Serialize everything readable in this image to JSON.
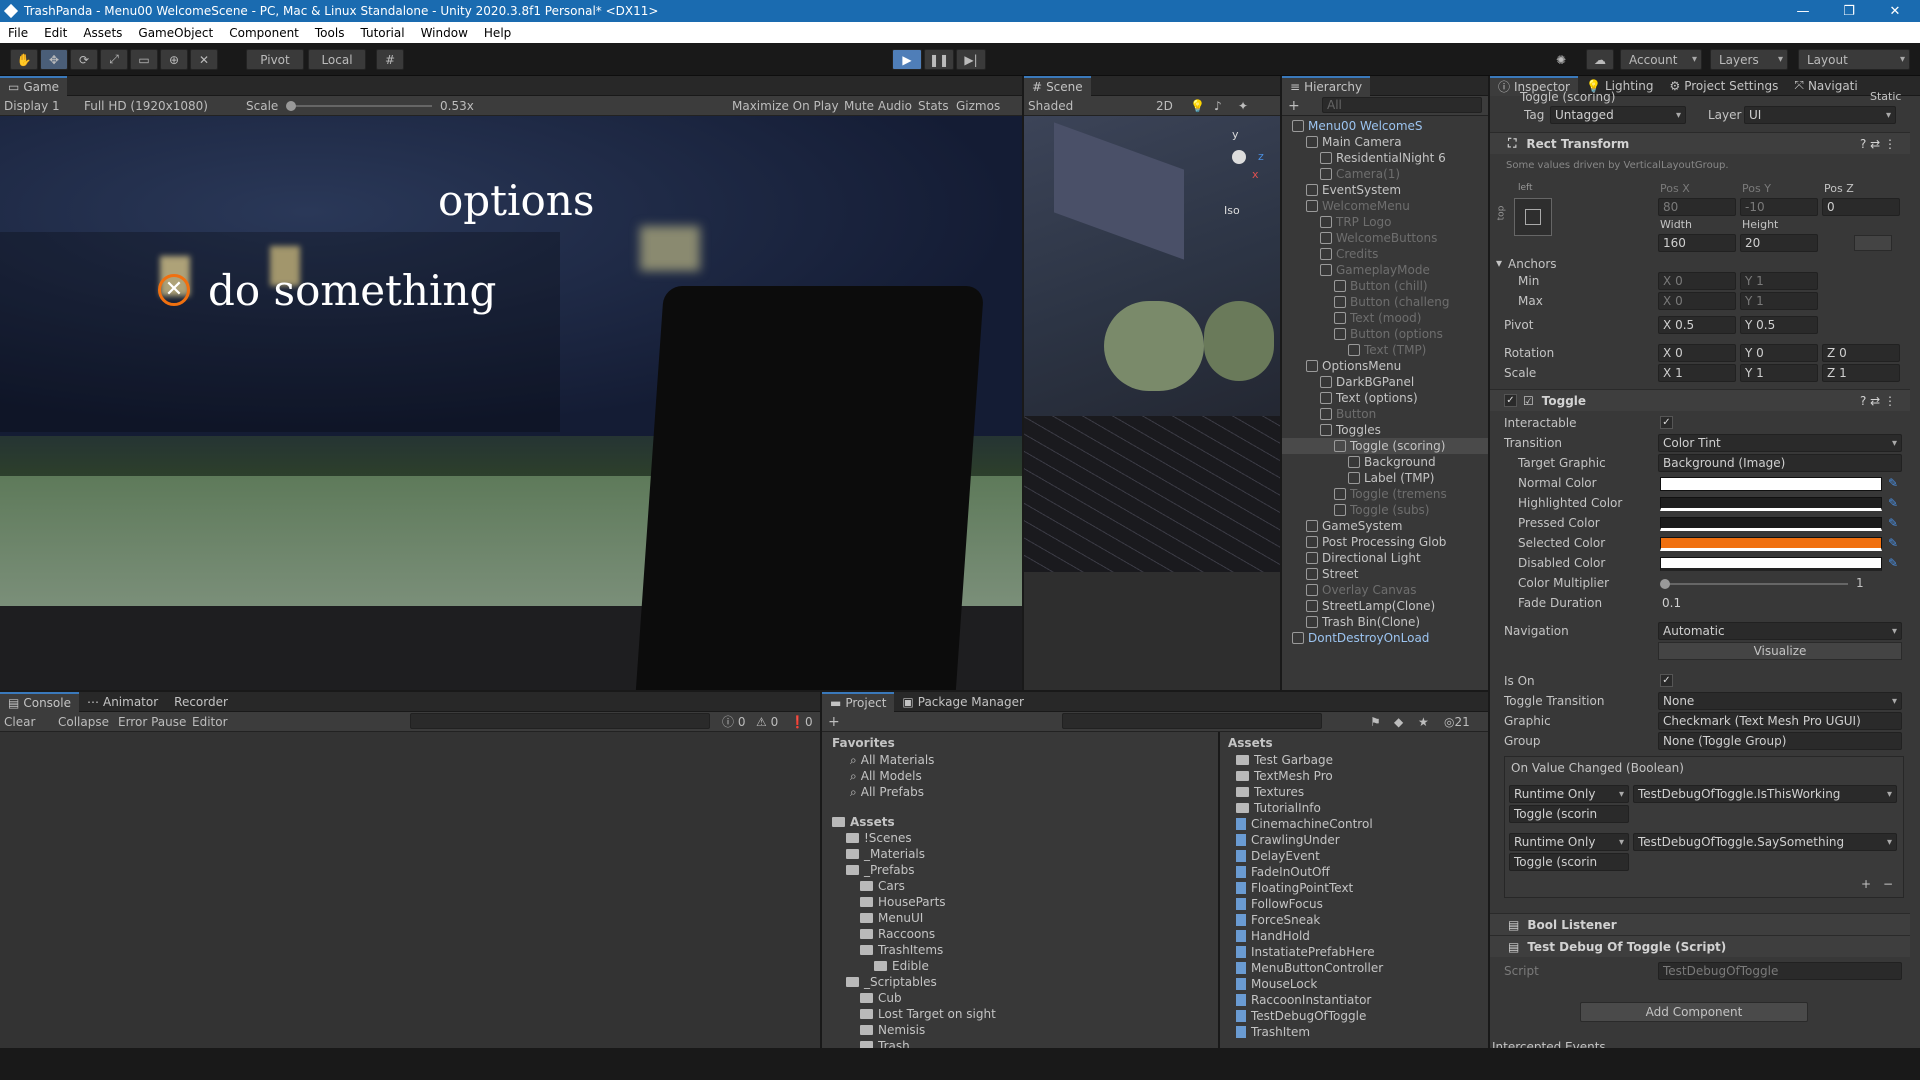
{
  "app": {
    "title": "TrashPanda - Menu00 WelcomeScene - PC, Mac & Linux Standalone - Unity 2020.3.8f1 Personal* <DX11>",
    "minimize": "—",
    "restore": "❐",
    "close": "✕"
  },
  "menu": [
    "File",
    "Edit",
    "Assets",
    "GameObject",
    "Component",
    "Tools",
    "Tutorial",
    "Window",
    "Help"
  ],
  "toolbar": {
    "pivot": "Pivot",
    "local": "Local",
    "account": "Account",
    "layers": "Layers",
    "layout": "Layout"
  },
  "game": {
    "tab": "Game",
    "display": "Display 1",
    "resolution": "Full HD (1920x1080)",
    "scale_label": "Scale",
    "scale_value": "0.53x",
    "maximize": "Maximize On Play",
    "mute": "Mute Audio",
    "stats": "Stats",
    "gizmos": "Gizmos",
    "overlay_title": "options",
    "overlay_item": "do something"
  },
  "scene": {
    "tab": "Scene",
    "shading": "Shaded",
    "mode2d": "2D",
    "iso": "Iso",
    "axis_y": "y",
    "axis_z": "z",
    "axis_x": "x"
  },
  "hierarchy": {
    "tab": "Hierarchy",
    "search_placeholder": "All",
    "items": [
      {
        "label": "Menu00 WelcomeS",
        "indent": 0,
        "state": "bold"
      },
      {
        "label": "Main Camera",
        "indent": 1,
        "state": ""
      },
      {
        "label": "ResidentialNight 6",
        "indent": 2,
        "state": ""
      },
      {
        "label": "Camera(1)",
        "indent": 2,
        "state": "dim"
      },
      {
        "label": "EventSystem",
        "indent": 1,
        "state": ""
      },
      {
        "label": "WelcomeMenu",
        "indent": 1,
        "state": "dim"
      },
      {
        "label": "TRP Logo",
        "indent": 2,
        "state": "dim"
      },
      {
        "label": "WelcomeButtons",
        "indent": 2,
        "state": "dim"
      },
      {
        "label": "Credits",
        "indent": 2,
        "state": "dim"
      },
      {
        "label": "GameplayMode",
        "indent": 2,
        "state": "dim"
      },
      {
        "label": "Button (chill)",
        "indent": 3,
        "state": "dim"
      },
      {
        "label": "Button (challeng",
        "indent": 3,
        "state": "dim"
      },
      {
        "label": "Text (mood)",
        "indent": 3,
        "state": "dim"
      },
      {
        "label": "Button (options",
        "indent": 3,
        "state": "dim"
      },
      {
        "label": "Text (TMP)",
        "indent": 4,
        "state": "dim"
      },
      {
        "label": "OptionsMenu",
        "indent": 1,
        "state": ""
      },
      {
        "label": "DarkBGPanel",
        "indent": 2,
        "state": ""
      },
      {
        "label": "Text (options)",
        "indent": 2,
        "state": ""
      },
      {
        "label": "Button",
        "indent": 2,
        "state": "dim"
      },
      {
        "label": "Toggles",
        "indent": 2,
        "state": ""
      },
      {
        "label": "Toggle (scoring)",
        "indent": 3,
        "state": "selected"
      },
      {
        "label": "Background",
        "indent": 4,
        "state": ""
      },
      {
        "label": "Label (TMP)",
        "indent": 4,
        "state": ""
      },
      {
        "label": "Toggle (tremens",
        "indent": 3,
        "state": "dim"
      },
      {
        "label": "Toggle (subs)",
        "indent": 3,
        "state": "dim"
      },
      {
        "label": "GameSystem",
        "indent": 1,
        "state": ""
      },
      {
        "label": "Post Processing Glob",
        "indent": 1,
        "state": ""
      },
      {
        "label": "Directional Light",
        "indent": 1,
        "state": ""
      },
      {
        "label": "Street",
        "indent": 1,
        "state": ""
      },
      {
        "label": "Overlay Canvas",
        "indent": 1,
        "state": "dim"
      },
      {
        "label": "StreetLamp(Clone)",
        "indent": 1,
        "state": ""
      },
      {
        "label": "Trash Bin(Clone)",
        "indent": 1,
        "state": ""
      },
      {
        "label": "DontDestroyOnLoad",
        "indent": 0,
        "state": "bold"
      }
    ]
  },
  "inspector": {
    "tabs": [
      "Inspector",
      "Lighting",
      "Project Settings",
      "Navigati"
    ],
    "object_name": "Toggle (scoring)",
    "static": "Static",
    "tag_label": "Tag",
    "tag_value": "Untagged",
    "layer_label": "Layer",
    "layer_value": "UI",
    "rect": {
      "title": "Rect Transform",
      "note": "Some values driven by VerticalLayoutGroup.",
      "anchor_preset": "left",
      "anchor_side": "top",
      "posx_label": "Pos X",
      "posy_label": "Pos Y",
      "posz_label": "Pos Z",
      "posx": "80",
      "posy": "-10",
      "posz": "0",
      "width_label": "Width",
      "height_label": "Height",
      "width": "160",
      "height": "20",
      "anchors": "Anchors",
      "min": "Min",
      "max": "Max",
      "min_x": "0",
      "min_y": "1",
      "max_x": "0",
      "max_y": "1",
      "pivot": "Pivot",
      "pivot_x": "0.5",
      "pivot_y": "0.5",
      "rotation": "Rotation",
      "rot_x": "0",
      "rot_y": "0",
      "rot_z": "0",
      "scale": "Scale",
      "scale_x": "1",
      "scale_y": "1",
      "scale_z": "1",
      "x": "X",
      "y": "Y",
      "z": "Z"
    },
    "toggle": {
      "title": "Toggle",
      "interactable": "Interactable",
      "transition": "Transition",
      "transition_value": "Color Tint",
      "target_graphic": "Target Graphic",
      "target_graphic_value": "Background (Image)",
      "normal": "Normal Color",
      "highlighted": "Highlighted Color",
      "pressed": "Pressed Color",
      "selected": "Selected Color",
      "disabled": "Disabled Color",
      "multiplier": "Color Multiplier",
      "multiplier_value": "1",
      "fade": "Fade Duration",
      "fade_value": "0.1",
      "navigation": "Navigation",
      "navigation_value": "Automatic",
      "visualize": "Visualize",
      "is_on": "Is On",
      "toggle_transition": "Toggle Transition",
      "toggle_transition_value": "None",
      "graphic": "Graphic",
      "graphic_value": "Checkmark (Text Mesh Pro UGUI)",
      "group": "Group",
      "group_value": "None (Toggle Group)",
      "event": "On Value Changed (Boolean)",
      "runtime": "Runtime Only",
      "fn1": "TestDebugOfToggle.IsThisWorking",
      "fn2": "TestDebugOfToggle.SaySomething",
      "obj": "Toggle (scorin",
      "plus": "+",
      "minus": "−"
    },
    "colors": {
      "normal": "#ffffff",
      "highlighted": "#1e1e1e",
      "pressed": "#1a1a1a",
      "selected": "#f07010",
      "disabled": "#ffffff"
    },
    "bool_listener": "Bool Listener",
    "test_debug": "Test Debug Of Toggle (Script)",
    "script_label": "Script",
    "script_value": "TestDebugOfToggle",
    "add_component": "Add Component",
    "intercepted": "Intercepted Events"
  },
  "console": {
    "tabs": [
      "Console",
      "Animator",
      "Recorder"
    ],
    "clear": "Clear",
    "collapse": "Collapse",
    "error_pause": "Error Pause",
    "editor": "Editor",
    "count_log": "0",
    "count_warn": "0",
    "count_err": "0"
  },
  "project": {
    "tabs": [
      "Project",
      "Package Manager"
    ],
    "favorites": "Favorites",
    "fav_items": [
      "All Materials",
      "All Models",
      "All Prefabs"
    ],
    "assets_root": "Assets",
    "tree": [
      {
        "label": "!Scenes",
        "indent": 1
      },
      {
        "label": "_Materials",
        "indent": 1
      },
      {
        "label": "_Prefabs",
        "indent": 1
      },
      {
        "label": "Cars",
        "indent": 2
      },
      {
        "label": "HouseParts",
        "indent": 2
      },
      {
        "label": "MenuUI",
        "indent": 2
      },
      {
        "label": "Raccoons",
        "indent": 2
      },
      {
        "label": "TrashItems",
        "indent": 2
      },
      {
        "label": "Edible",
        "indent": 3
      },
      {
        "label": "_Scriptables",
        "indent": 1
      },
      {
        "label": "Cub",
        "indent": 2
      },
      {
        "label": "Lost Target on sight",
        "indent": 2
      },
      {
        "label": "Nemisis",
        "indent": 2
      },
      {
        "label": "Trash",
        "indent": 2
      }
    ],
    "assets_header": "Assets",
    "files": [
      {
        "label": "Test Garbage",
        "type": "folder"
      },
      {
        "label": "TextMesh Pro",
        "type": "folder"
      },
      {
        "label": "Textures",
        "type": "folder"
      },
      {
        "label": "TutorialInfo",
        "type": "folder"
      },
      {
        "label": "CinemachineControl",
        "type": "script"
      },
      {
        "label": "CrawlingUnder",
        "type": "script"
      },
      {
        "label": "DelayEvent",
        "type": "script"
      },
      {
        "label": "FadeInOutOff",
        "type": "script"
      },
      {
        "label": "FloatingPointText",
        "type": "script"
      },
      {
        "label": "FollowFocus",
        "type": "script"
      },
      {
        "label": "ForceSneak",
        "type": "script"
      },
      {
        "label": "HandHold",
        "type": "script"
      },
      {
        "label": "InstatiatePrefabHere",
        "type": "script"
      },
      {
        "label": "MenuButtonController",
        "type": "script"
      },
      {
        "label": "MouseLock",
        "type": "script"
      },
      {
        "label": "RaccoonInstantiator",
        "type": "script"
      },
      {
        "label": "TestDebugOfToggle",
        "type": "script"
      },
      {
        "label": "TrashItem",
        "type": "script"
      }
    ],
    "hidden_count": "21"
  }
}
